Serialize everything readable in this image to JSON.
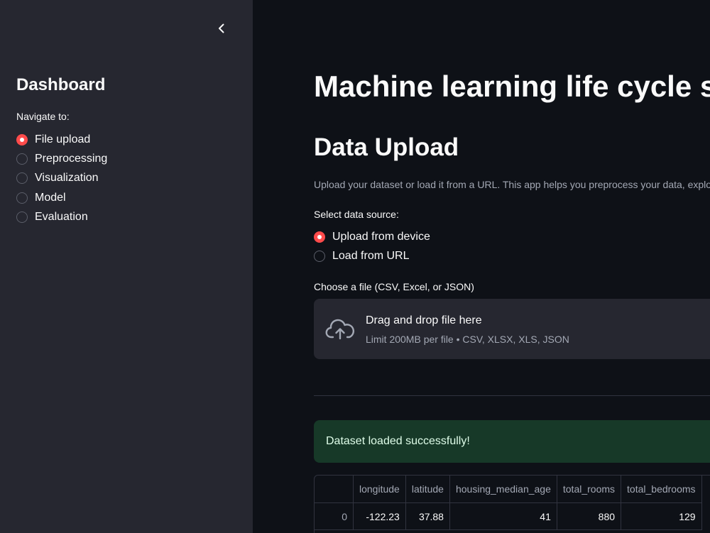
{
  "sidebar": {
    "title": "Dashboard",
    "nav_label": "Navigate to:",
    "items": [
      {
        "label": "File upload",
        "selected": true
      },
      {
        "label": "Preprocessing",
        "selected": false
      },
      {
        "label": "Visualization",
        "selected": false
      },
      {
        "label": "Model",
        "selected": false
      },
      {
        "label": "Evaluation",
        "selected": false
      }
    ],
    "collapse_icon": "chevron-left-icon"
  },
  "main": {
    "title": "Machine learning life cycle s",
    "section_title": "Data Upload",
    "description": "Upload your dataset or load it from a URL. This app helps you preprocess your data, explor",
    "source_label": "Select data source:",
    "source_options": [
      {
        "label": "Upload from device",
        "selected": true
      },
      {
        "label": "Load from URL",
        "selected": false
      }
    ],
    "file_label": "Choose a file (CSV, Excel, or JSON)",
    "dropzone": {
      "icon": "cloud-upload-icon",
      "title": "Drag and drop file here",
      "subtitle": "Limit 200MB per file • CSV, XLSX, XLS, JSON"
    },
    "success_message": "Dataset loaded successfully!",
    "table": {
      "columns": [
        "",
        "longitude",
        "latitude",
        "housing_median_age",
        "total_rooms",
        "total_bedrooms"
      ],
      "rows": [
        [
          "0",
          "-122.23",
          "37.88",
          "41",
          "880",
          "129"
        ]
      ]
    }
  },
  "colors": {
    "accent": "#ff4b4b",
    "sidebar_bg": "#262730",
    "main_bg": "#0e1117",
    "success_bg": "#173928"
  }
}
